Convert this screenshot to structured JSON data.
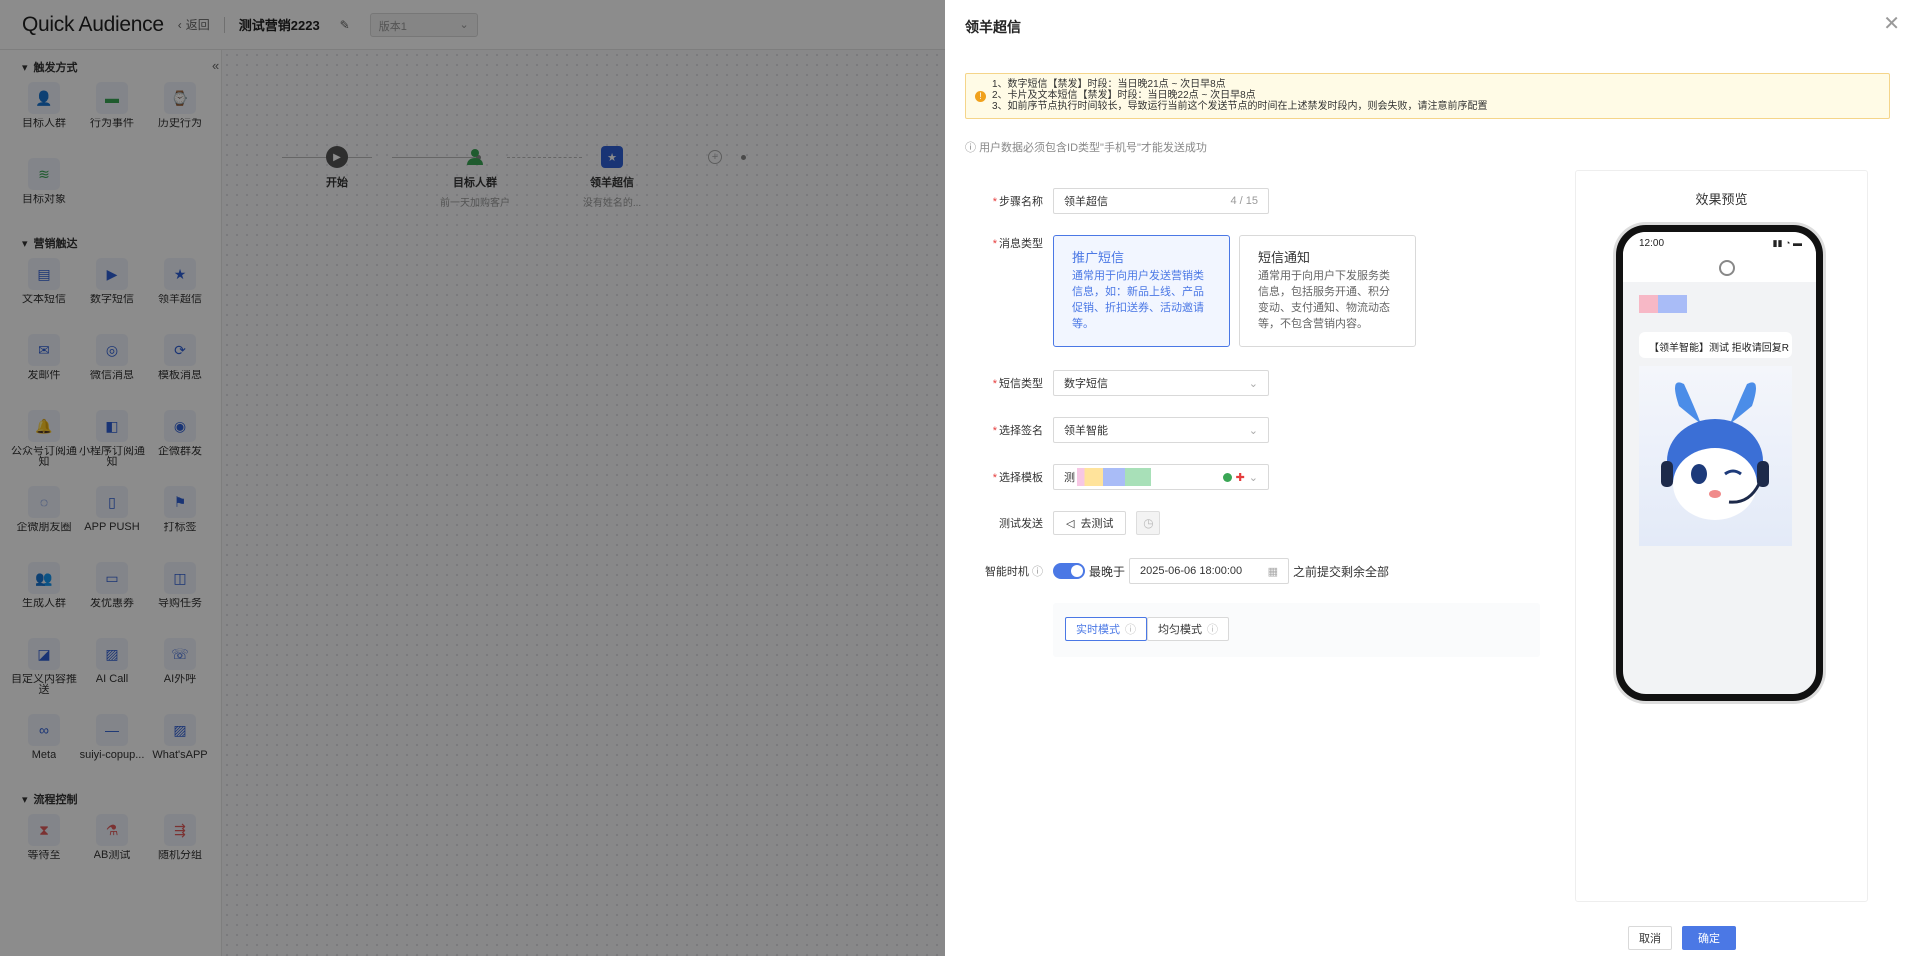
{
  "header": {
    "logo": "Quick Audience",
    "back_label": "返回",
    "flow_name": "测试营销2223",
    "version_placeholder": "版本1"
  },
  "sidebar": {
    "sections": [
      {
        "title": "触发方式",
        "items": [
          {
            "label": "目标人群",
            "icon": "users-icon"
          },
          {
            "label": "行为事件",
            "icon": "folder-icon"
          },
          {
            "label": "历史行为",
            "icon": "history-icon"
          },
          {
            "label": "目标对象",
            "icon": "stack-icon"
          }
        ]
      },
      {
        "title": "营销触达",
        "items": [
          {
            "label": "文本短信",
            "icon": "message-icon"
          },
          {
            "label": "数字短信",
            "icon": "video-message-icon"
          },
          {
            "label": "领羊超信",
            "icon": "super-sms-icon"
          },
          {
            "label": "发邮件",
            "icon": "mail-icon"
          },
          {
            "label": "微信消息",
            "icon": "wechat-icon"
          },
          {
            "label": "模板消息",
            "icon": "template-icon"
          },
          {
            "label": "公众号订阅通知",
            "icon": "bell-icon"
          },
          {
            "label": "小程序订阅通知",
            "icon": "miniapp-icon"
          },
          {
            "label": "企微群发",
            "icon": "wecom-icon"
          },
          {
            "label": "企微朋友圈",
            "icon": "moments-icon"
          },
          {
            "label": "APP PUSH",
            "icon": "phone-icon"
          },
          {
            "label": "打标签",
            "icon": "tag-icon"
          },
          {
            "label": "生成人群",
            "icon": "group-icon"
          },
          {
            "label": "发优惠券",
            "icon": "coupon-icon"
          },
          {
            "label": "导购任务",
            "icon": "bag-icon"
          },
          {
            "label": "自定义内容推送",
            "icon": "custom-push-icon"
          },
          {
            "label": "AI Call",
            "icon": "broken-image-icon"
          },
          {
            "label": "AI外呼",
            "icon": "call-icon"
          },
          {
            "label": "Meta",
            "icon": "meta-icon"
          },
          {
            "label": "suiyi-copup...",
            "icon": "suiyi-icon"
          },
          {
            "label": "What'sAPP",
            "icon": "broken-image-icon"
          }
        ]
      },
      {
        "title": "流程控制",
        "items": [
          {
            "label": "等待至",
            "icon": "hourglass-icon"
          },
          {
            "label": "AB测试",
            "icon": "flask-icon"
          },
          {
            "label": "随机分组",
            "icon": "split-icon"
          }
        ]
      }
    ]
  },
  "canvas": {
    "nodes": [
      {
        "label": "开始",
        "sub": ""
      },
      {
        "label": "目标人群",
        "sub": "前一天加购客户"
      },
      {
        "label": "领羊超信",
        "sub": "没有姓名的..."
      }
    ]
  },
  "drawer": {
    "title": "领羊超信",
    "warnings": [
      "1、数字短信【禁发】时段：当日晚21点 ~ 次日早8点",
      "2、卡片及文本短信【禁发】时段：当日晚22点 ~ 次日早8点",
      "3、如前序节点执行时间较长，导致运行当前这个发送节点的时间在上述禁发时段内，则会失败，请注意前序配置"
    ],
    "note": "用户数据必须包含ID类型\"手机号\"才能发送成功",
    "form": {
      "step_name_label": "步骤名称",
      "step_name_value": "领羊超信",
      "step_name_count": "4 / 15",
      "msg_type_label": "消息类型",
      "msg_types": [
        {
          "title": "推广短信",
          "desc": "通常用于向用户发送营销类信息，如：新品上线、产品促销、折扣送券、活动邀请等。"
        },
        {
          "title": "短信通知",
          "desc": "通常用于向用户下发服务类信息，包括服务开通、积分变动、支付通知、物流动态等，不包含营销内容。"
        }
      ],
      "sms_type_label": "短信类型",
      "sms_type_value": "数字短信",
      "sign_label": "选择签名",
      "sign_value": "领羊智能",
      "template_label": "选择模板",
      "template_value": "测",
      "test_label": "测试发送",
      "test_button": "去测试",
      "smart_label": "智能时机",
      "smart_prefix": "最晚于",
      "smart_datetime": "2025-06-06 18:00:00",
      "smart_suffix": "之前提交剩余全部",
      "modes": [
        "实时模式",
        "均匀模式"
      ]
    },
    "preview": {
      "title": "效果预览",
      "time": "12:00",
      "message": "【领羊智能】测试 拒收请回复R"
    },
    "footer": {
      "cancel": "取消",
      "confirm": "确定"
    }
  },
  "colors": {
    "primary": "#4b78e5",
    "success": "#3aa655",
    "warn_bg": "#fffbe6",
    "danger": "#e53c3c"
  }
}
